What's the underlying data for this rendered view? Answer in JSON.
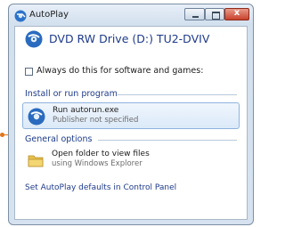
{
  "window": {
    "title": "AutoPlay",
    "close_glyph": "x",
    "icons": {
      "app": "autoplay-icon",
      "minimize": "minimize-icon",
      "maximize": "maximize-icon",
      "close": "close-icon"
    }
  },
  "drive": {
    "name": "DVD RW Drive (D:) TU2-DVIV",
    "icon": "disc-drive-icon"
  },
  "checkbox": {
    "label": "Always do this for software and games:",
    "checked": false
  },
  "install_section": {
    "heading": "Install or run program",
    "option": {
      "title": "Run autorun.exe",
      "subtitle": "Publisher not specified",
      "icon": "program-icon",
      "selected": true
    }
  },
  "general_section": {
    "heading": "General options",
    "option": {
      "title": "Open folder to view files",
      "subtitle": "using Windows Explorer",
      "icon": "folder-icon"
    }
  },
  "footer": {
    "link": "Set AutoPlay defaults in Control Panel"
  },
  "colors": {
    "accent": "#1e3b8a",
    "callout": "#e0761c",
    "close": "#c8412b"
  }
}
